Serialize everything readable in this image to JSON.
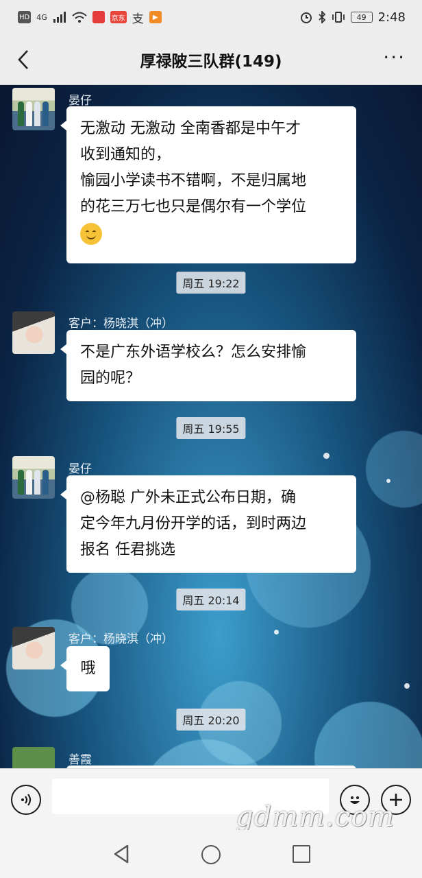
{
  "status_bar": {
    "network_hd": "HD",
    "network_4g": "4G",
    "battery": "49",
    "time": "2:48",
    "app_icon_labels": [
      "京东",
      "支"
    ]
  },
  "header": {
    "title": "厚禄陂三队群(149)",
    "back_icon": "chevron-left-icon",
    "more_icon": "more-dots-icon",
    "more_label": "···"
  },
  "messages": [
    {
      "sender": "晏仔",
      "lines": [
        "无激动 无激动 全南香都是中午才",
        "收到通知的，",
        "愉园小学读书不错啊，不是归属地",
        "的花三万七也只是偶尔有一个学位"
      ],
      "emoji": "smile-emoji"
    },
    {
      "time": "周五 19:22"
    },
    {
      "sender": "客户：杨晓淇（冲）",
      "lines": [
        "不是广东外语学校么？怎么安排愉",
        "园的呢？"
      ]
    },
    {
      "time": "周五 19:55"
    },
    {
      "sender": "晏仔",
      "lines": [
        "@杨聪   广外未正式公布日期，确",
        "定今年九月份开学的话，到时两边",
        "报名 任君挑选"
      ]
    },
    {
      "time": "周五 20:14"
    },
    {
      "sender": "客户：杨晓淇（冲）",
      "lines": [
        "哦"
      ]
    },
    {
      "time": "周五 20:20"
    },
    {
      "sender": "善霞",
      "lines": []
    }
  ],
  "input_bar": {
    "voice_icon": "voice-icon",
    "emoji_icon": "emoji-icon",
    "plus_icon": "plus-icon",
    "text_value": ""
  },
  "watermark": "gdmm.com",
  "colors": {
    "bubble": "#ffffff",
    "header": "#ededed",
    "chat_bg": "#0c1d33"
  }
}
